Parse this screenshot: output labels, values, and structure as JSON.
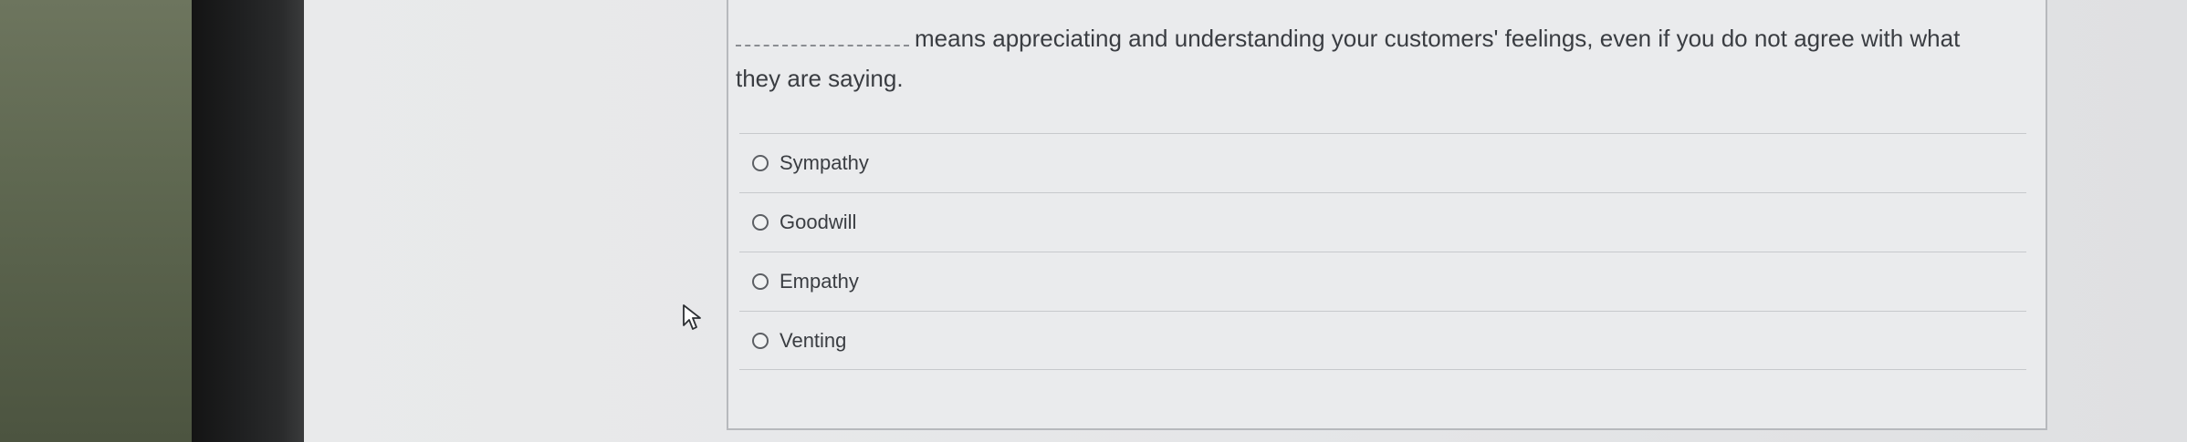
{
  "question": {
    "text_after_blank": "means appreciating and understanding your customers' feelings, even if you do not agree with what they are saying."
  },
  "options": [
    {
      "label": "Sympathy"
    },
    {
      "label": "Goodwill"
    },
    {
      "label": "Empathy"
    },
    {
      "label": "Venting"
    }
  ],
  "icons": {
    "cursor": "mouse-pointer-icon"
  }
}
